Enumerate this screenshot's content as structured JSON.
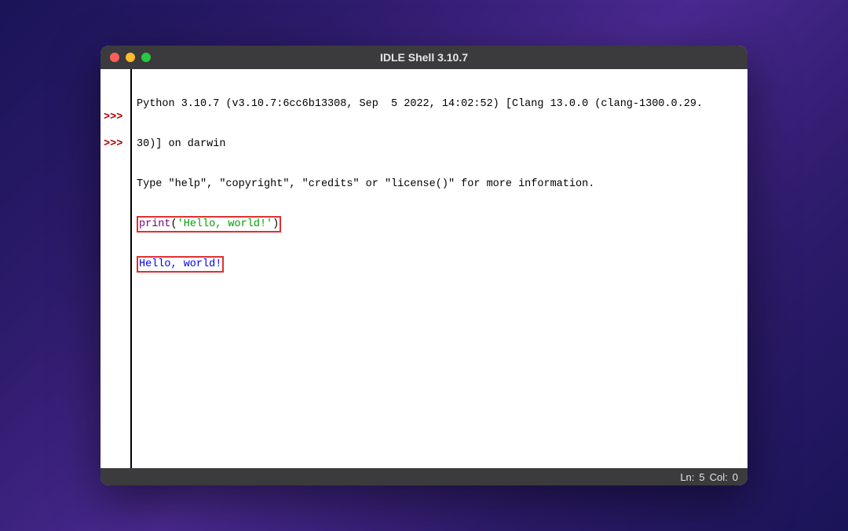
{
  "window": {
    "title": "IDLE Shell 3.10.7"
  },
  "gutter": {
    "prompt1": ">>>",
    "prompt2": ">>>"
  },
  "shell": {
    "banner1": "Python 3.10.7 (v3.10.7:6cc6b13308, Sep  5 2022, 14:02:52) [Clang 13.0.0 (clang-1300.0.29.",
    "banner2": "30)] on darwin",
    "banner3": "Type \"help\", \"copyright\", \"credits\" or \"license()\" for more information.",
    "input_print": "print",
    "input_paren_open": "(",
    "input_string": "'Hello, world!'",
    "input_paren_close": ")",
    "output": "Hello, world!"
  },
  "status": {
    "line_label": "Ln:",
    "line_value": "5",
    "col_label": "Col:",
    "col_value": "0"
  }
}
